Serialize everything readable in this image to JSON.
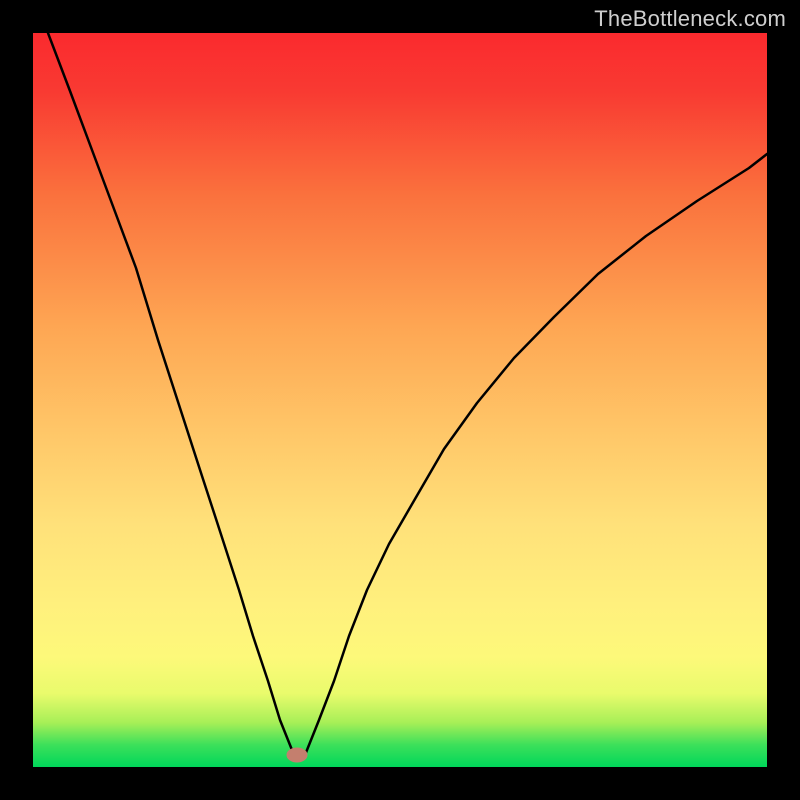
{
  "watermark": {
    "text": "TheBottleneck.com"
  },
  "chart_data": {
    "type": "line",
    "title": "",
    "xlabel": "",
    "ylabel": "",
    "xlim": [
      0,
      1
    ],
    "ylim": [
      0,
      1
    ],
    "x": [
      0.02,
      0.05,
      0.08,
      0.11,
      0.14,
      0.17,
      0.2,
      0.23,
      0.25,
      0.28,
      0.3,
      0.32,
      0.337,
      0.355,
      0.37,
      0.39,
      0.41,
      0.43,
      0.455,
      0.485,
      0.52,
      0.56,
      0.605,
      0.655,
      0.71,
      0.77,
      0.835,
      0.905,
      0.975,
      1.0
    ],
    "y": [
      1.0,
      0.92,
      0.84,
      0.76,
      0.68,
      0.582,
      0.489,
      0.396,
      0.334,
      0.241,
      0.179,
      0.117,
      0.064,
      0.016,
      0.016,
      0.064,
      0.117,
      0.179,
      0.241,
      0.303,
      0.365,
      0.434,
      0.496,
      0.558,
      0.613,
      0.672,
      0.723,
      0.771,
      0.816,
      0.835
    ],
    "marker_location": {
      "x": 0.36,
      "y": 0.016
    }
  },
  "colors": {
    "gradient_top": "#fa2a2e",
    "gradient_bottom": "#00d75a",
    "curve": "#000000",
    "marker": "#c47f6e",
    "frame": "#000000",
    "watermark": "#cfcfcf"
  }
}
